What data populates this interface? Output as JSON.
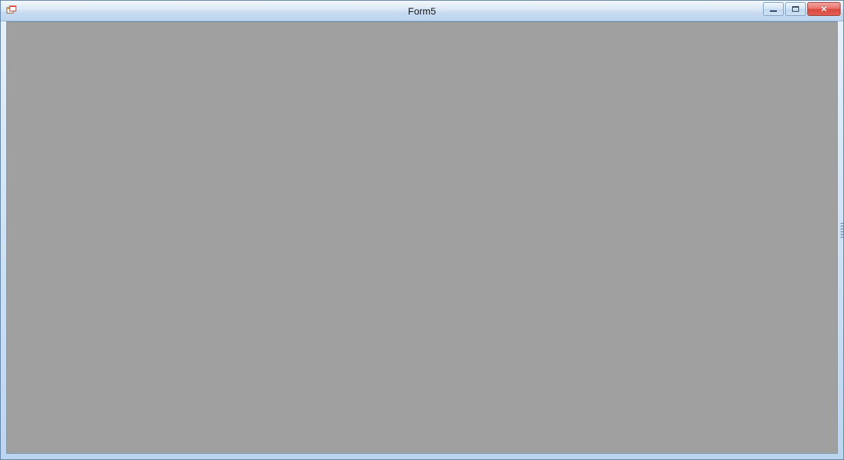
{
  "window": {
    "title": "Form5"
  }
}
